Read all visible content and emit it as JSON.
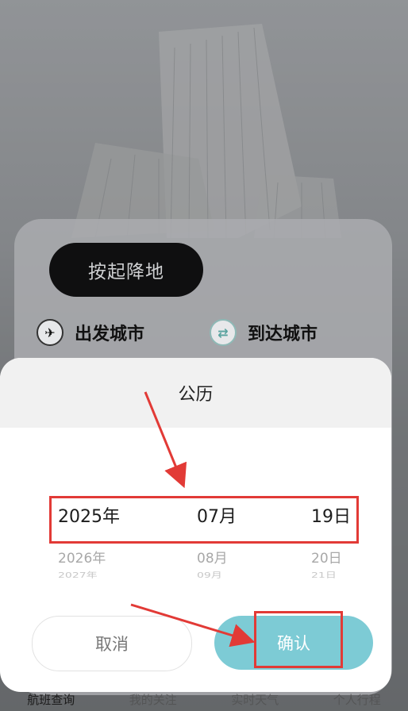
{
  "search": {
    "mode_button": "按起降地",
    "departure_label": "出发城市",
    "arrival_label": "到达城市",
    "departure_icon": "plane-icon",
    "arrival_icon": "swap-icon"
  },
  "tabs": [
    {
      "label": "航班查询",
      "active": true
    },
    {
      "label": "我的关注",
      "active": false
    },
    {
      "label": "实时天气",
      "active": false
    },
    {
      "label": "个人行程",
      "active": false
    }
  ],
  "date_picker": {
    "title": "公历",
    "rows": [
      {
        "year": "2025年",
        "month": "07月",
        "day": "19日",
        "state": "selected"
      },
      {
        "year": "2026年",
        "month": "08月",
        "day": "20日",
        "state": "next"
      },
      {
        "year": "2027年",
        "month": "09月",
        "day": "21日",
        "state": "next2"
      }
    ],
    "cancel_label": "取消",
    "confirm_label": "确认"
  },
  "colors": {
    "accent": "#7dcbd5",
    "annotation": "#e23a36",
    "button_dark": "#0f0f10"
  }
}
